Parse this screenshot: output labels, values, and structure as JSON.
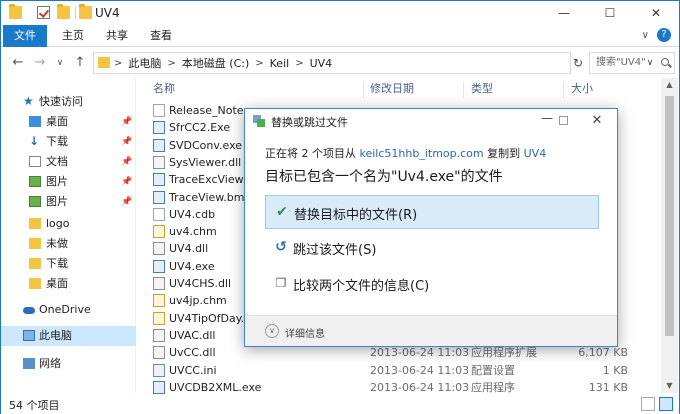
{
  "window": {
    "title": "UV4",
    "controls": {
      "minimize": "—",
      "maximize": "☐",
      "close": "✕"
    }
  },
  "ribbon": {
    "tabs": [
      "文件",
      "主页",
      "共享",
      "查看"
    ],
    "expand": "∨",
    "help": "?"
  },
  "nav": {
    "back": "←",
    "forward": "→",
    "dropdown": "∨",
    "up": "↑",
    "breadcrumb": [
      "此电脑",
      "本地磁盘 (C:)",
      "Keil",
      "UV4"
    ],
    "separator": ">",
    "refresh": "↻",
    "search_placeholder": "搜索\"UV4\""
  },
  "sidebar": {
    "items": [
      {
        "label": "快速访问",
        "pinned": false
      },
      {
        "label": "桌面",
        "pinned": true
      },
      {
        "label": "下载",
        "pinned": true
      },
      {
        "label": "文档",
        "pinned": true
      },
      {
        "label": "图片",
        "pinned": true
      },
      {
        "label": "图片",
        "pinned": true
      },
      {
        "label": "logo",
        "pinned": false
      },
      {
        "label": "未做",
        "pinned": false
      },
      {
        "label": "下载",
        "pinned": false
      },
      {
        "label": "桌面",
        "pinned": false
      },
      {
        "label": "OneDrive",
        "pinned": false
      },
      {
        "label": "此电脑",
        "pinned": false
      },
      {
        "label": "网络",
        "pinned": false
      }
    ]
  },
  "columns": {
    "name": "名称",
    "date": "修改日期",
    "type": "类型",
    "size": "大小"
  },
  "files": [
    {
      "name": "Release_Notes.",
      "date": "",
      "type": "",
      "size": "",
      "kind": "file"
    },
    {
      "name": "SfrCC2.Exe",
      "date": "",
      "type": "",
      "size": "",
      "kind": "exe"
    },
    {
      "name": "SVDConv.exe",
      "date": "",
      "type": "",
      "size": "",
      "kind": "exe"
    },
    {
      "name": "SysViewer.dll",
      "date": "",
      "type": "",
      "size": "",
      "kind": "dll"
    },
    {
      "name": "TraceExcView.b",
      "date": "",
      "type": "",
      "size": "",
      "kind": "exe"
    },
    {
      "name": "TraceView.bmp",
      "date": "",
      "type": "",
      "size": "",
      "kind": "exe"
    },
    {
      "name": "UV4.cdb",
      "date": "",
      "type": "",
      "size": "",
      "kind": "file"
    },
    {
      "name": "uv4.chm",
      "date": "",
      "type": "",
      "size": "",
      "kind": "chm"
    },
    {
      "name": "UV4.dll",
      "date": "",
      "type": "",
      "size": "",
      "kind": "dll"
    },
    {
      "name": "UV4.exe",
      "date": "",
      "type": "",
      "size": "",
      "kind": "exe"
    },
    {
      "name": "UV4CHS.dll",
      "date": "",
      "type": "",
      "size": "",
      "kind": "dll"
    },
    {
      "name": "uv4jp.chm",
      "date": "",
      "type": "",
      "size": "",
      "kind": "chm"
    },
    {
      "name": "UV4TipOfDay.cl",
      "date": "",
      "type": "",
      "size": "",
      "kind": "chm"
    },
    {
      "name": "UVAC.dll",
      "date": "",
      "type": "",
      "size": "",
      "kind": "dll"
    },
    {
      "name": "UvCC.dll",
      "date": "2013-06-24 11:03",
      "type": "应用程序扩展",
      "size": "6,107 KB",
      "kind": "dll"
    },
    {
      "name": "UVCC.ini",
      "date": "2013-06-24 11:03",
      "type": "配置设置",
      "size": "1 KB",
      "kind": "ini"
    },
    {
      "name": "UVCDB2XML.exe",
      "date": "2013-06-24 11:03",
      "type": "应用程序",
      "size": "131 KB",
      "kind": "exe"
    }
  ],
  "status": {
    "count": "54 个项目"
  },
  "dialog": {
    "title": "替换或跳过文件",
    "line1_prefix": "正在将 2 个项目从 ",
    "line1_source": "keilc51hhb_itmop.com",
    "line1_middle": " 复制到 ",
    "line1_dest": "UV4",
    "line2": "目标已包含一个名为\"Uv4.exe\"的文件",
    "options": [
      {
        "label": "替换目标中的文件(R)",
        "icon": "check-icon"
      },
      {
        "label": "跳过该文件(S)",
        "icon": "skip-icon"
      },
      {
        "label": "比较两个文件的信息(C)",
        "icon": "compare-icon"
      }
    ],
    "details": "详细信息"
  }
}
